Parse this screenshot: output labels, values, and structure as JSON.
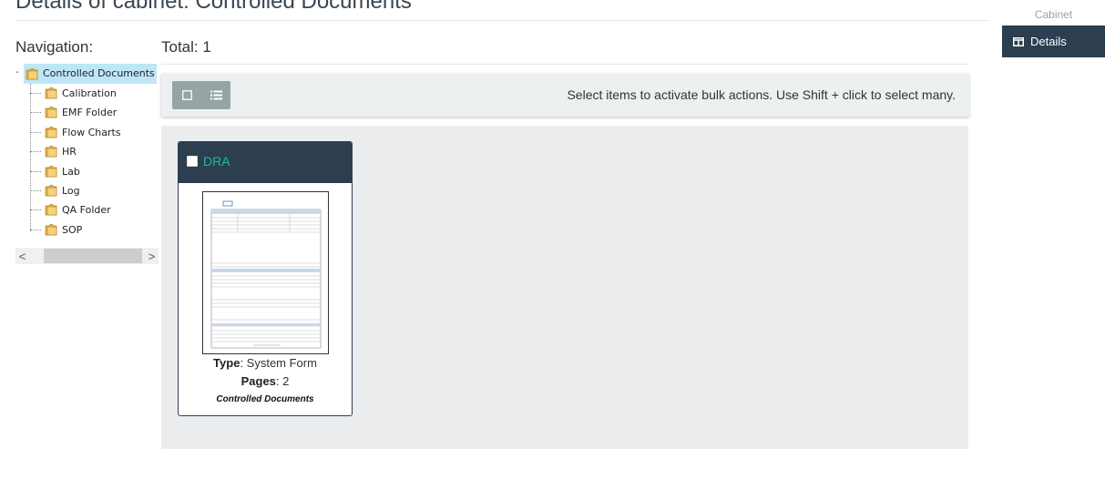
{
  "header": {
    "page_title": "Details of cabinet: Controlled Documents"
  },
  "right_panel": {
    "section_label": "Cabinet",
    "items": [
      {
        "label": "Details",
        "icon": "columns-icon"
      }
    ]
  },
  "navigation": {
    "label": "Navigation:",
    "root": {
      "label": "Controlled Documents",
      "expander": "-"
    },
    "children": [
      {
        "label": "Calibration"
      },
      {
        "label": "EMF Folder"
      },
      {
        "label": "Flow Charts"
      },
      {
        "label": "HR"
      },
      {
        "label": "Lab"
      },
      {
        "label": "Log"
      },
      {
        "label": "QA Folder"
      },
      {
        "label": "SOP"
      }
    ],
    "scroll_left": "<",
    "scroll_right": ">"
  },
  "results": {
    "total_label": "Total: 1",
    "bulk_actions_hint": "Select items to activate bulk actions. Use Shift + click to select many."
  },
  "documents": [
    {
      "title": "DRA",
      "type_label": "Type",
      "type_value": ": System Form",
      "pages_label": "Pages",
      "pages_value": ": 2",
      "cabinet": "Controlled Documents"
    }
  ],
  "colors": {
    "header_dark": "#2c3e50",
    "accent_green": "#18bc9c",
    "tree_highlight": "#bee7f6",
    "toolbar_bg": "#ecf0f1",
    "button_gray": "#95a5a6"
  }
}
